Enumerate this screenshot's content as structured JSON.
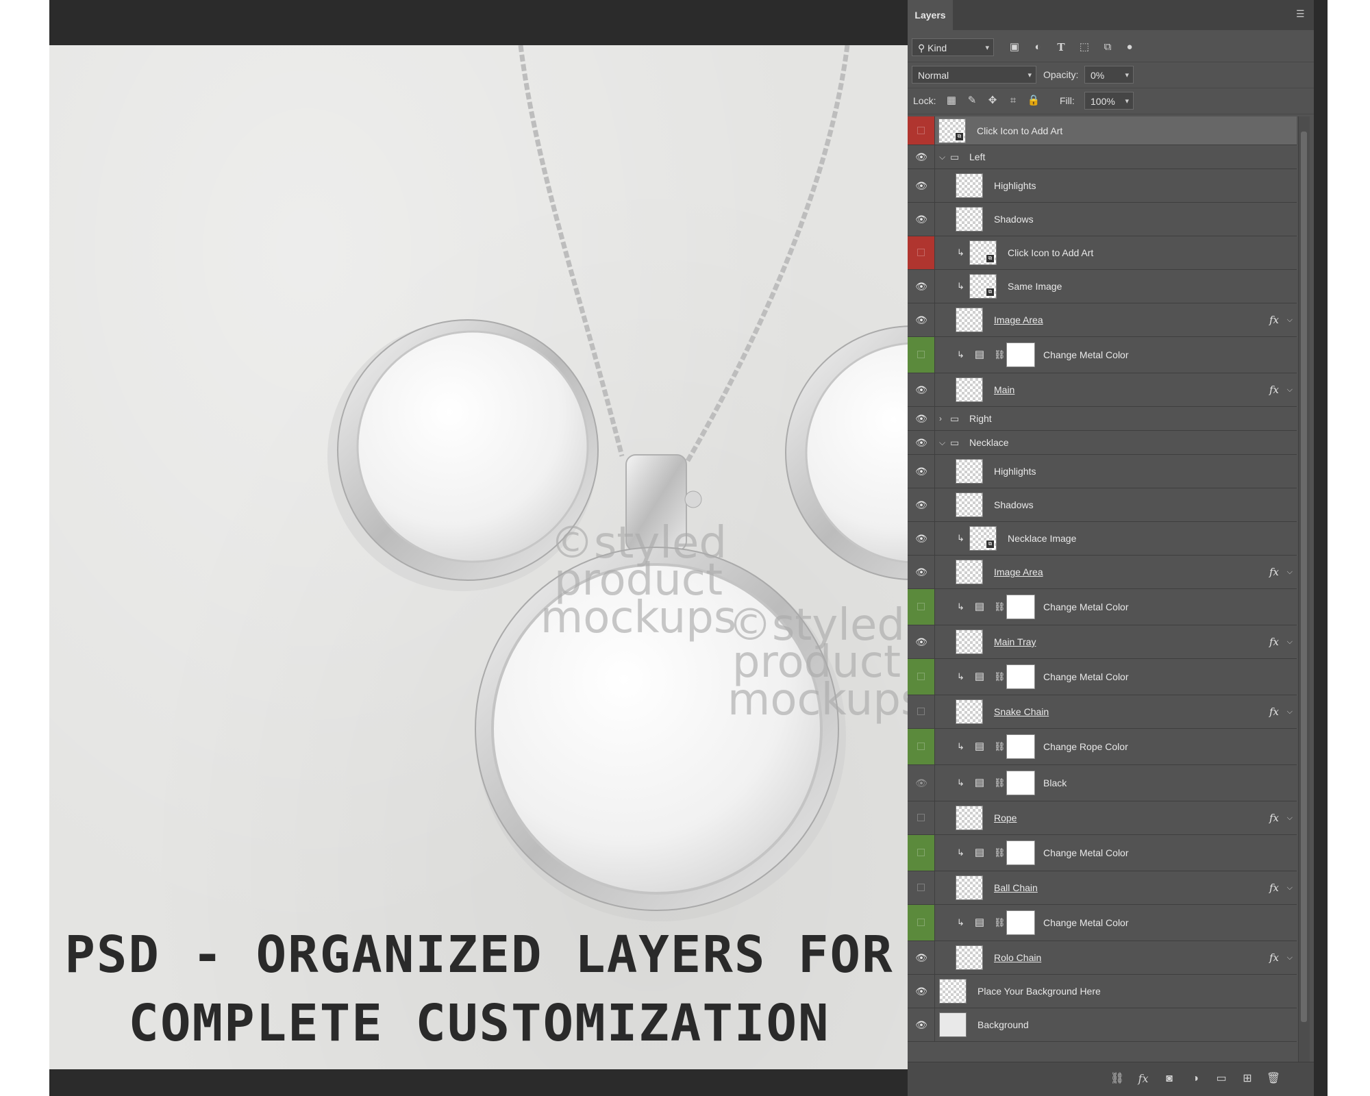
{
  "canvas": {
    "caption_line1": "PSD - ORGANIZED LAYERS FOR",
    "caption_line2": "COMPLETE CUSTOMIZATION",
    "watermark_1": "©styled product mockups",
    "watermark_2": "©styled product mockups"
  },
  "panel": {
    "tab_label": "Layers",
    "menu_icon": "panel-menu-icon",
    "filter_kind": "Kind",
    "blend_mode": "Normal",
    "opacity_label": "Opacity:",
    "opacity_value": "0%",
    "lock_label": "Lock:",
    "fill_label": "Fill:",
    "fill_value": "100%"
  },
  "layers": [
    {
      "name": "Click Icon to Add Art",
      "vis": "red",
      "type": "smart",
      "indent": 0,
      "selected": true
    },
    {
      "name": "Left",
      "vis": "eye",
      "type": "group",
      "open": true,
      "indent": 0
    },
    {
      "name": "Highlights",
      "vis": "eye",
      "type": "pixel",
      "indent": 1
    },
    {
      "name": "Shadows",
      "vis": "eye",
      "type": "pixel",
      "indent": 1
    },
    {
      "name": "Click Icon to Add Art",
      "vis": "red",
      "type": "smart",
      "indent": 1,
      "clip": true
    },
    {
      "name": "Same Image",
      "vis": "eye",
      "type": "smart",
      "indent": 1,
      "clip": true
    },
    {
      "name": "Image Area",
      "vis": "eye",
      "type": "pixel",
      "indent": 1,
      "fx": true
    },
    {
      "name": "Change Metal Color",
      "vis": "green",
      "type": "adjust",
      "indent": 1,
      "clip": true
    },
    {
      "name": "Main",
      "vis": "eye",
      "type": "pixel",
      "indent": 1,
      "fx": true
    },
    {
      "name": "Right",
      "vis": "eye",
      "type": "group",
      "open": false,
      "indent": 0
    },
    {
      "name": "Necklace",
      "vis": "eye",
      "type": "group",
      "open": true,
      "indent": 0
    },
    {
      "name": "Highlights",
      "vis": "eye",
      "type": "pixel",
      "indent": 1
    },
    {
      "name": "Shadows",
      "vis": "eye",
      "type": "pixel",
      "indent": 1
    },
    {
      "name": "Necklace Image",
      "vis": "eye",
      "type": "smart",
      "indent": 1,
      "clip": true
    },
    {
      "name": "Image Area",
      "vis": "eye",
      "type": "pixel",
      "indent": 1,
      "fx": true
    },
    {
      "name": "Change Metal Color",
      "vis": "green",
      "type": "adjust",
      "indent": 1,
      "clip": true
    },
    {
      "name": "Main Tray",
      "vis": "eye",
      "type": "pixel",
      "indent": 1,
      "fx": true
    },
    {
      "name": "Change Metal Color",
      "vis": "green",
      "type": "adjust",
      "indent": 1,
      "clip": true
    },
    {
      "name": "Snake Chain",
      "vis": "off",
      "type": "pixel",
      "indent": 1,
      "fx": true
    },
    {
      "name": "Change Rope Color",
      "vis": "green",
      "type": "adjust",
      "indent": 1,
      "clip": true
    },
    {
      "name": "Black",
      "vis": "eye-dim",
      "type": "adjust",
      "indent": 1,
      "clip": true
    },
    {
      "name": "Rope",
      "vis": "off",
      "type": "pixel",
      "indent": 1,
      "fx": true
    },
    {
      "name": "Change Metal Color",
      "vis": "green",
      "type": "adjust",
      "indent": 1,
      "clip": true
    },
    {
      "name": "Ball Chain",
      "vis": "off",
      "type": "pixel",
      "indent": 1,
      "fx": true
    },
    {
      "name": "Change Metal Color",
      "vis": "green",
      "type": "adjust",
      "indent": 1,
      "clip": true
    },
    {
      "name": "Rolo Chain",
      "vis": "eye",
      "type": "pixel",
      "indent": 1,
      "fx": true
    },
    {
      "name": "Place Your Background Here",
      "vis": "eye",
      "type": "pixel",
      "indent": 0
    },
    {
      "name": "Background",
      "vis": "eye",
      "type": "bg",
      "indent": 0
    }
  ],
  "footer_buttons": [
    "link-layers-icon",
    "fx-icon",
    "mask-icon",
    "adjustment-icon",
    "new-group-icon",
    "new-layer-icon",
    "trash-icon"
  ]
}
